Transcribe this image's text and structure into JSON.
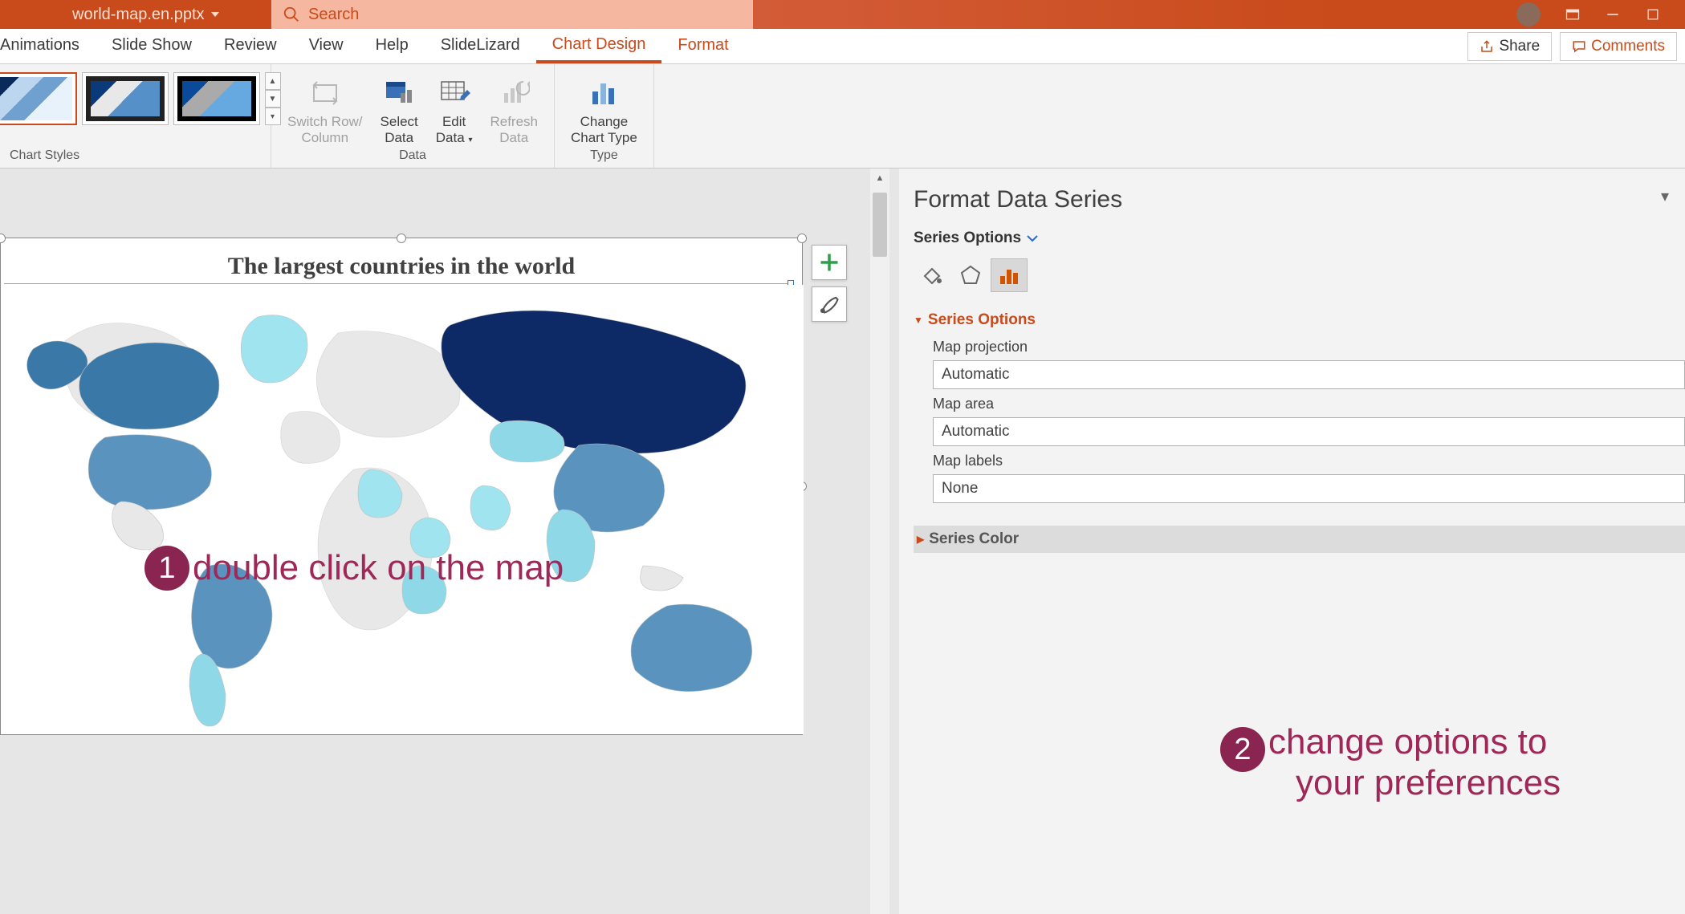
{
  "title_bar": {
    "document_name": "world-map.en.pptx",
    "search_placeholder": "Search"
  },
  "ribbon_tabs": {
    "items": [
      "Animations",
      "Slide Show",
      "Review",
      "View",
      "Help",
      "SlideLizard",
      "Chart Design",
      "Format"
    ],
    "active": "Chart Design",
    "share_label": "Share",
    "comments_label": "Comments"
  },
  "ribbon": {
    "chart_styles_label": "Chart Styles",
    "data_group_label": "Data",
    "type_group_label": "Type",
    "switch_label": "Switch Row/\nColumn",
    "select_data_label": "Select\nData",
    "edit_data_label": "Edit\nData",
    "refresh_label": "Refresh\nData",
    "change_type_label": "Change\nChart Type"
  },
  "chart": {
    "title": "The largest countries in the world"
  },
  "pane": {
    "title": "Format Data Series",
    "series_options_btn": "Series Options",
    "section_series_options": "Series Options",
    "map_projection_label": "Map projection",
    "map_projection_value": "Automatic",
    "map_area_label": "Map area",
    "map_area_value": "Automatic",
    "map_labels_label": "Map labels",
    "map_labels_value": "None",
    "section_series_color": "Series Color"
  },
  "annotations": {
    "a1_num": "1",
    "a1_text": "double click on the map",
    "a2_num": "2",
    "a2_text_l1": "change options to",
    "a2_text_l2": "your preferences"
  }
}
